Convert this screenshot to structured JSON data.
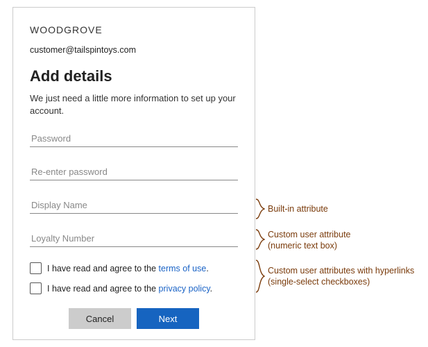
{
  "brand": "WOODGROVE",
  "email": "customer@tailspintoys.com",
  "heading": "Add details",
  "subtext": "We just need a little more information to set up your account.",
  "fields": {
    "password": "Password",
    "repassword": "Re-enter password",
    "displayName": "Display Name",
    "loyaltyNumber": "Loyalty Number"
  },
  "consent": {
    "prefix": "I have read and agree to the ",
    "termsLink": "terms of use",
    "privacyLink": "privacy policy",
    "suffix": "."
  },
  "buttons": {
    "cancel": "Cancel",
    "next": "Next"
  },
  "annotations": {
    "builtin": "Built-in attribute",
    "custom1a": "Custom user attribute",
    "custom1b": "(numeric text box)",
    "custom2a": "Custom user attributes with hyperlinks",
    "custom2b": "(single-select checkboxes)"
  }
}
